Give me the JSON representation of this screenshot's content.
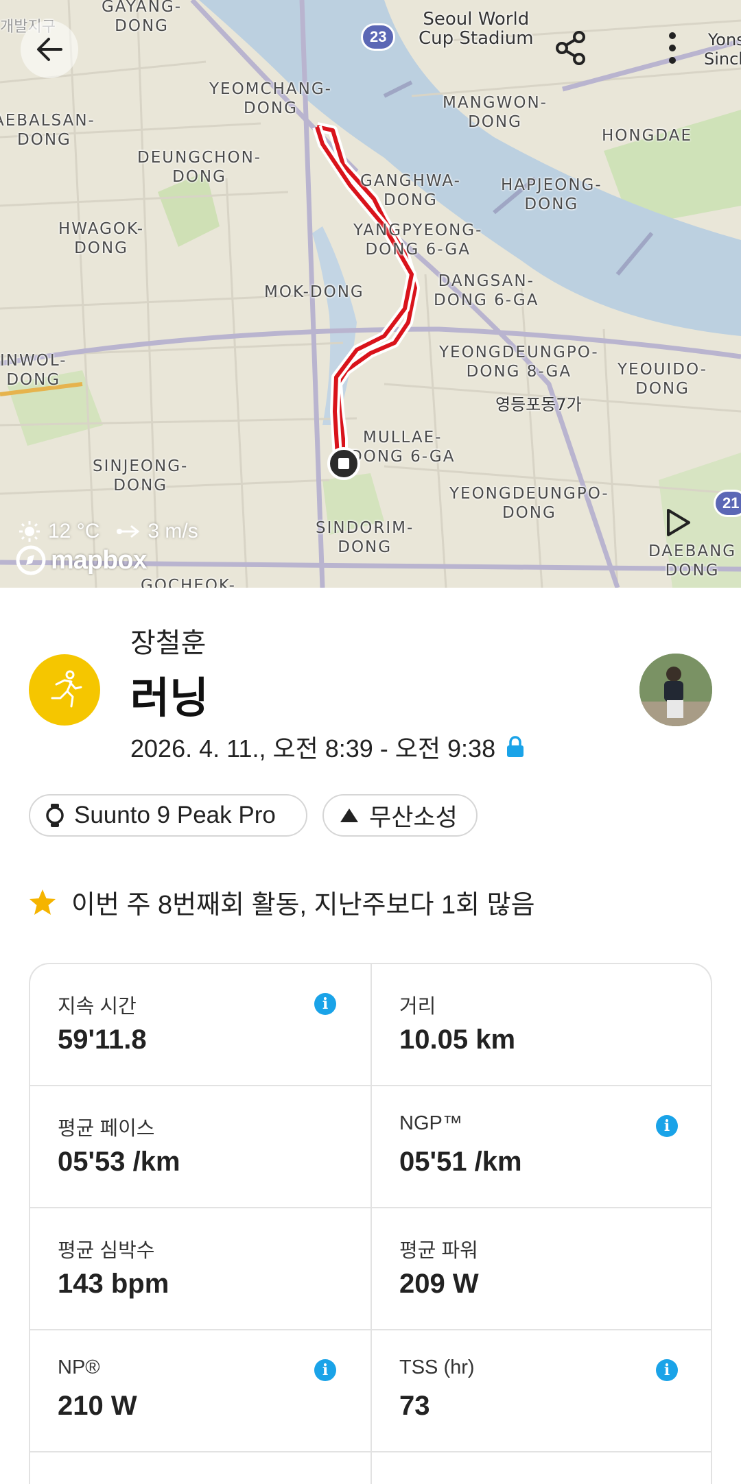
{
  "map": {
    "labels": [
      {
        "text": "GAYANG-\nDONG"
      },
      {
        "text": "YEOMCHANG-\nDONG"
      },
      {
        "text": "AEBALSAN-\nDONG"
      },
      {
        "text": "DEUNGCHON-\nDONG"
      },
      {
        "text": "HWAGOK-\nDONG"
      },
      {
        "text": "MOK-DONG"
      },
      {
        "text": "INWOL-\nDONG"
      },
      {
        "text": "SINJEONG-\nDONG"
      },
      {
        "text": "SINDORIM-\nDONG"
      },
      {
        "text": "GOCHEOK-"
      },
      {
        "text": "MANGWON-\nDONG"
      },
      {
        "text": "HONGDAE"
      },
      {
        "text": "GANGHWA-\nDONG"
      },
      {
        "text": "HAPJEONG-\nDONG"
      },
      {
        "text": "YANGPYEONG-\nDONG 6-GA"
      },
      {
        "text": "DANGSAN-\nDONG 6-GA"
      },
      {
        "text": "YEONGDEUNGPO-\nDONG 8-GA"
      },
      {
        "text": "YEOUIDO-\nDONG"
      },
      {
        "text": "MULLAE-\nDONG 6-GA"
      },
      {
        "text": "YEONGDEUNGPO-\nDONG"
      },
      {
        "text": "DAEBANG\nDONG"
      },
      {
        "text": "Yons\nSinch"
      },
      {
        "text": "Seoul World\nCup Stadium"
      },
      {
        "text": "영등포동7가"
      },
      {
        "text": "개발지구"
      }
    ],
    "route_badge_1": "23",
    "route_badge_2": "21",
    "weather": {
      "temperature": "12 °C",
      "wind": "3 m/s"
    },
    "attribution": "mapbox"
  },
  "toolbar": {
    "back_icon": "arrow-left-icon",
    "share_icon": "share-icon",
    "more_icon": "more-vertical-icon",
    "play_icon": "play-icon"
  },
  "activity": {
    "user_name": "장철훈",
    "title": "러닝",
    "time_range": "2026. 4. 11., 오전 8:39 - 오전 9:38",
    "icon": "running-icon",
    "icon_color": "#f5c600",
    "lock_icon": "lock-icon",
    "accent_color": "#1aa3e8"
  },
  "chips": {
    "device": "Suunto 9 Peak Pro",
    "location": "무산소성"
  },
  "achievement": "이번 주 8번째회 활동, 지난주보다 1회 많음",
  "stats": [
    {
      "label": "지속 시간",
      "value": "59'11.8"
    },
    {
      "label": "거리",
      "value": "10.05 km"
    },
    {
      "label": "평균 페이스",
      "value": "05'53 /km"
    },
    {
      "label": "NGP™",
      "value": "05'51 /km"
    },
    {
      "label": "평균 심박수",
      "value": "143 bpm"
    },
    {
      "label": "평균 파워",
      "value": "209 W"
    },
    {
      "label": "NP®",
      "value": "210 W"
    },
    {
      "label": "TSS (hr)",
      "value": "73"
    }
  ]
}
